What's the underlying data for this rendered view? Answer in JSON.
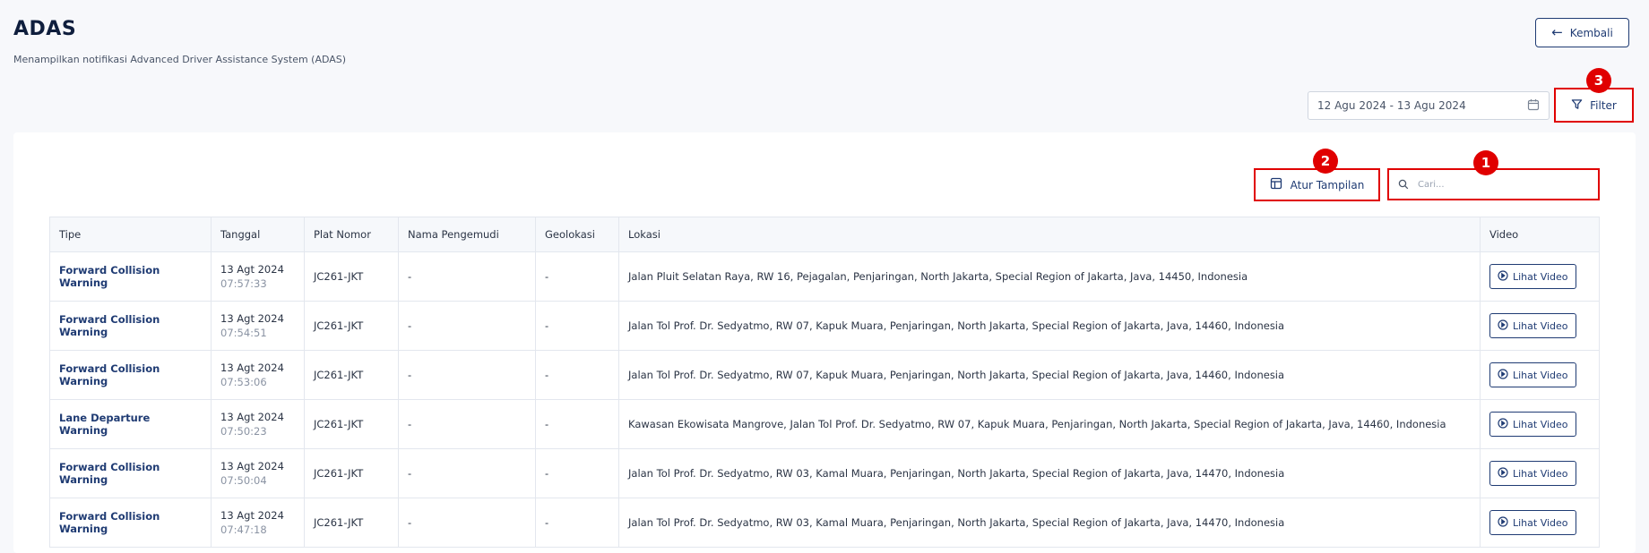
{
  "header": {
    "title": "ADAS",
    "subtitle": "Menampilkan notifikasi Advanced Driver Assistance System (ADAS)",
    "back_label": "Kembali"
  },
  "toolbar": {
    "date_range": "12 Agu 2024 - 13 Agu 2024",
    "filter_label": "Filter",
    "display_label": "Atur Tampilan",
    "search_placeholder": "Cari..."
  },
  "annotations": {
    "search": "1",
    "display": "2",
    "filter": "3"
  },
  "table": {
    "columns": [
      "Tipe",
      "Tanggal",
      "Plat Nomor",
      "Nama Pengemudi",
      "Geolokasi",
      "Lokasi",
      "Video"
    ],
    "video_label": "Lihat Video",
    "rows": [
      {
        "tipe": "Forward Collision Warning",
        "date": "13 Agt 2024",
        "time": "07:57:33",
        "plate": "JC261-JKT",
        "driver": "-",
        "geo": "-",
        "lokasi": "Jalan Pluit Selatan Raya, RW 16, Pejagalan, Penjaringan, North Jakarta, Special Region of Jakarta, Java, 14450, Indonesia"
      },
      {
        "tipe": "Forward Collision Warning",
        "date": "13 Agt 2024",
        "time": "07:54:51",
        "plate": "JC261-JKT",
        "driver": "-",
        "geo": "-",
        "lokasi": "Jalan Tol Prof. Dr. Sedyatmo, RW 07, Kapuk Muara, Penjaringan, North Jakarta, Special Region of Jakarta, Java, 14460, Indonesia"
      },
      {
        "tipe": "Forward Collision Warning",
        "date": "13 Agt 2024",
        "time": "07:53:06",
        "plate": "JC261-JKT",
        "driver": "-",
        "geo": "-",
        "lokasi": "Jalan Tol Prof. Dr. Sedyatmo, RW 07, Kapuk Muara, Penjaringan, North Jakarta, Special Region of Jakarta, Java, 14460, Indonesia"
      },
      {
        "tipe": "Lane Departure Warning",
        "date": "13 Agt 2024",
        "time": "07:50:23",
        "plate": "JC261-JKT",
        "driver": "-",
        "geo": "-",
        "lokasi": "Kawasan Ekowisata Mangrove, Jalan Tol Prof. Dr. Sedyatmo, RW 07, Kapuk Muara, Penjaringan, North Jakarta, Special Region of Jakarta, Java, 14460, Indonesia"
      },
      {
        "tipe": "Forward Collision Warning",
        "date": "13 Agt 2024",
        "time": "07:50:04",
        "plate": "JC261-JKT",
        "driver": "-",
        "geo": "-",
        "lokasi": "Jalan Tol Prof. Dr. Sedyatmo, RW 03, Kamal Muara, Penjaringan, North Jakarta, Special Region of Jakarta, Java, 14470, Indonesia"
      },
      {
        "tipe": "Forward Collision Warning",
        "date": "13 Agt 2024",
        "time": "07:47:18",
        "plate": "JC261-JKT",
        "driver": "-",
        "geo": "-",
        "lokasi": "Jalan Tol Prof. Dr. Sedyatmo, RW 03, Kamal Muara, Penjaringan, North Jakarta, Special Region of Jakarta, Java, 14470, Indonesia"
      }
    ]
  },
  "colors": {
    "primary": "#1f3b73",
    "annotation": "#e00000"
  }
}
